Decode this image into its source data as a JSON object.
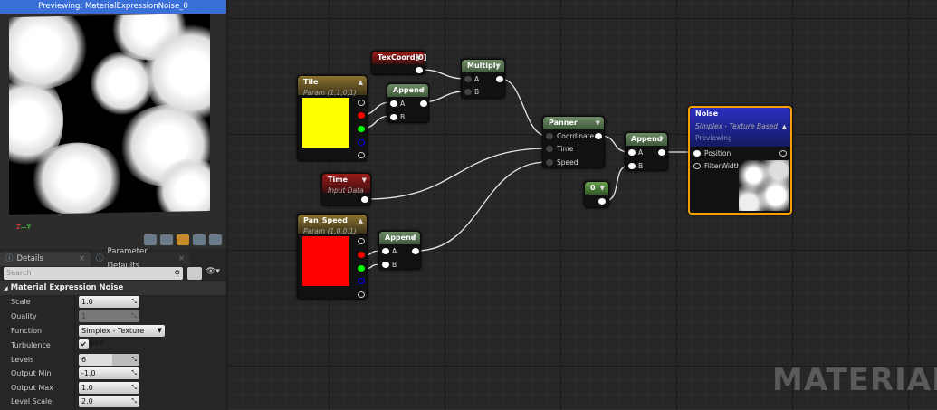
{
  "preview": {
    "title": "Previewing: MaterialExpressionNoise_0",
    "axis_z": "Z",
    "axis_y": "Y"
  },
  "tabs": [
    {
      "label": "Details",
      "close": "×"
    },
    {
      "label": "Parameter Defaults",
      "close": "×"
    }
  ],
  "search": {
    "placeholder": "Search"
  },
  "section": {
    "title": "Material Expression Noise",
    "icon": "◢"
  },
  "properties": [
    {
      "label": "Scale",
      "value": "1.0"
    },
    {
      "label": "Quality",
      "value": "1"
    },
    {
      "label": "Function",
      "value": "Simplex - Texture Based"
    },
    {
      "label": "Turbulence",
      "value": "✔"
    },
    {
      "label": "Levels",
      "value": "6",
      "slider_fraction": 0.55
    },
    {
      "label": "Output Min",
      "value": "-1.0"
    },
    {
      "label": "Output Max",
      "value": "1.0"
    },
    {
      "label": "Level Scale",
      "value": "2.0"
    }
  ],
  "nodes": {
    "texcoord": {
      "title": "TexCoord[0]"
    },
    "tile": {
      "title": "Tile",
      "subtitle": "Param (1,1,0,1)",
      "color": "#ffff00"
    },
    "append1": {
      "title": "Append",
      "a": "A",
      "b": "B"
    },
    "multiply": {
      "title": "Multiply",
      "a": "A",
      "b": "B"
    },
    "panner": {
      "title": "Panner",
      "coordinate": "Coordinate",
      "time": "Time",
      "speed": "Speed"
    },
    "time": {
      "title": "Time",
      "subtitle": "Input Data"
    },
    "pan_speed": {
      "title": "Pan_Speed",
      "subtitle": "Param (1,0,0,1)",
      "color": "#ff0000"
    },
    "append2": {
      "title": "Append",
      "a": "A",
      "b": "B"
    },
    "append3": {
      "title": "Append",
      "a": "A",
      "b": "B"
    },
    "constant": {
      "title": "0"
    },
    "noise": {
      "title": "Noise",
      "subtitle": "Simplex - Texture Based",
      "status": "Previewing",
      "position": "Position",
      "filterwidth": "FilterWidth"
    }
  },
  "watermark": "MATERIAL"
}
